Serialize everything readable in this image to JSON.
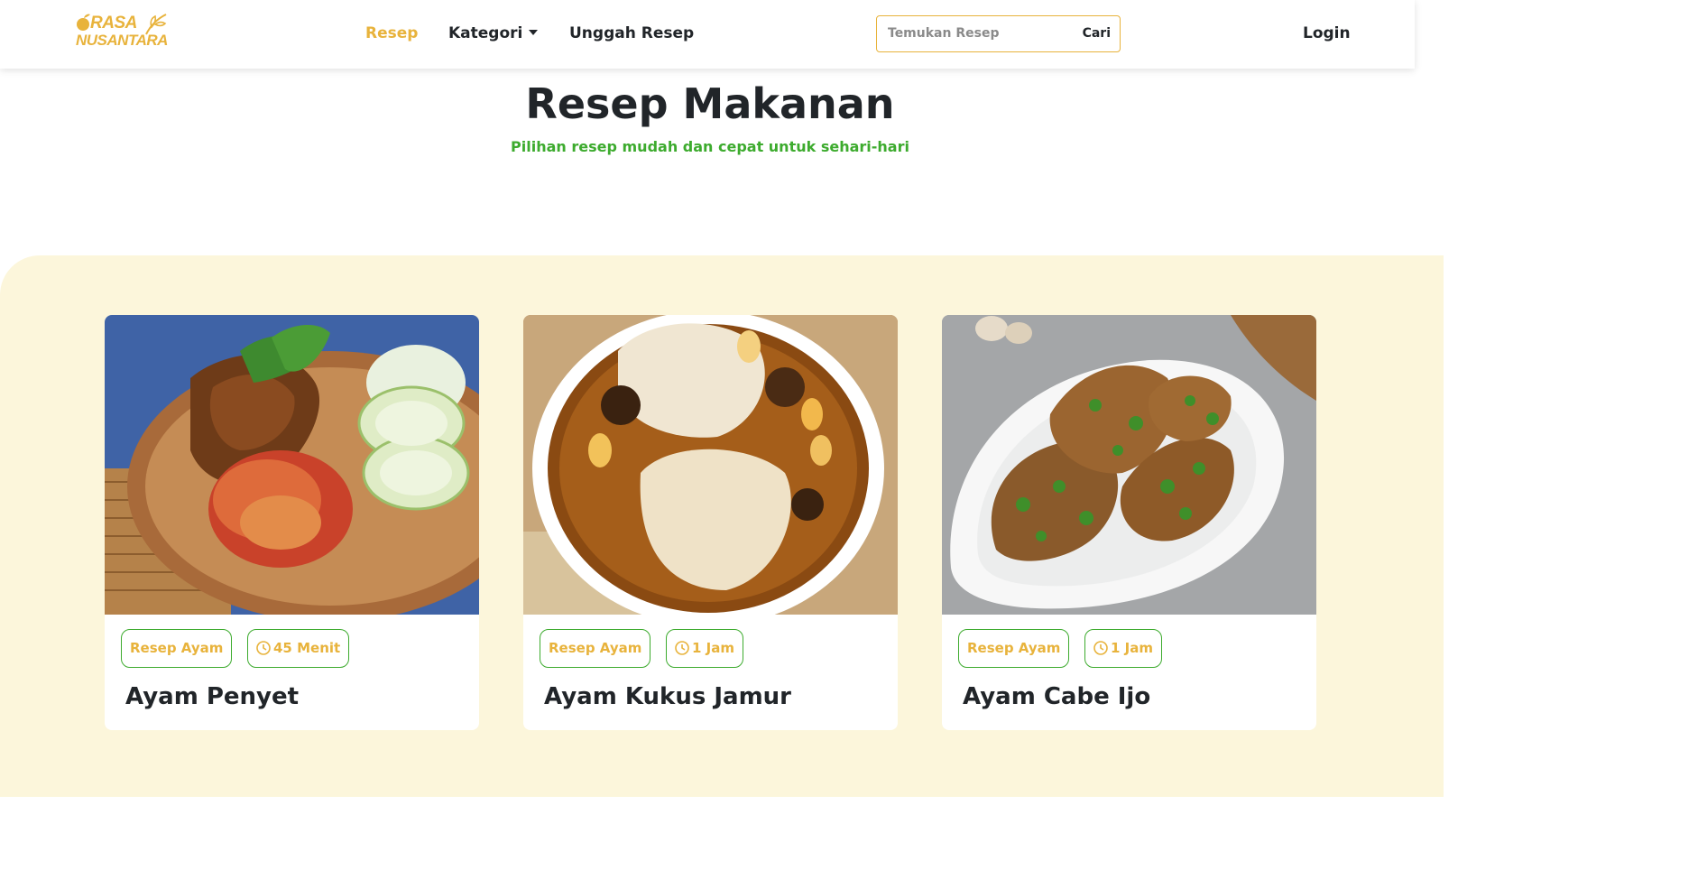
{
  "brand": {
    "line1": "RASA",
    "line2": "NUSANTARA"
  },
  "nav": {
    "resep": "Resep",
    "kategori": "Kategori",
    "unggah": "Unggah Resep",
    "login": "Login"
  },
  "search": {
    "placeholder": "Temukan Resep",
    "value": "",
    "button": "Cari"
  },
  "hero": {
    "title": "Resep Makanan",
    "subtitle": "Pilihan resep mudah dan cepat untuk sehari-hari"
  },
  "recipes": [
    {
      "category": "Resep Ayam",
      "time": "45 Menit",
      "title": "Ayam Penyet"
    },
    {
      "category": "Resep Ayam",
      "time": "1 Jam",
      "title": "Ayam Kukus Jamur"
    },
    {
      "category": "Resep Ayam",
      "time": "1 Jam",
      "title": "Ayam Cabe Ijo"
    }
  ],
  "colors": {
    "accent": "#e8b33c",
    "green": "#3dab2e",
    "section_bg": "#fcf6db",
    "text": "#212529"
  },
  "icons": {
    "logo_fruit": "orange-fruit-icon",
    "logo_leaf": "leaf-icon",
    "dropdown": "caret-down-icon",
    "time": "clock-icon"
  }
}
